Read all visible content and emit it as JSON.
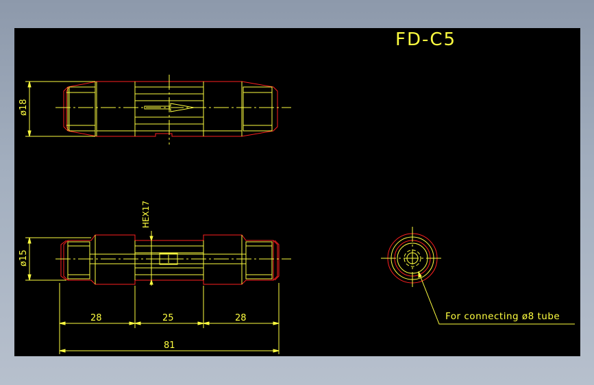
{
  "drawing": {
    "title": "FD-C5",
    "colors": {
      "background": "#000000",
      "outline": "#ff2020",
      "detail": "#ffff40",
      "frame": "#8f9aad"
    },
    "dimensions": {
      "top_diameter": "ø18",
      "bottom_diameter": "ø15",
      "hex": "HEX17",
      "segment_left": "28",
      "segment_mid": "25",
      "segment_right": "28",
      "overall": "81"
    },
    "annotation": "For connecting ø8 tube"
  }
}
